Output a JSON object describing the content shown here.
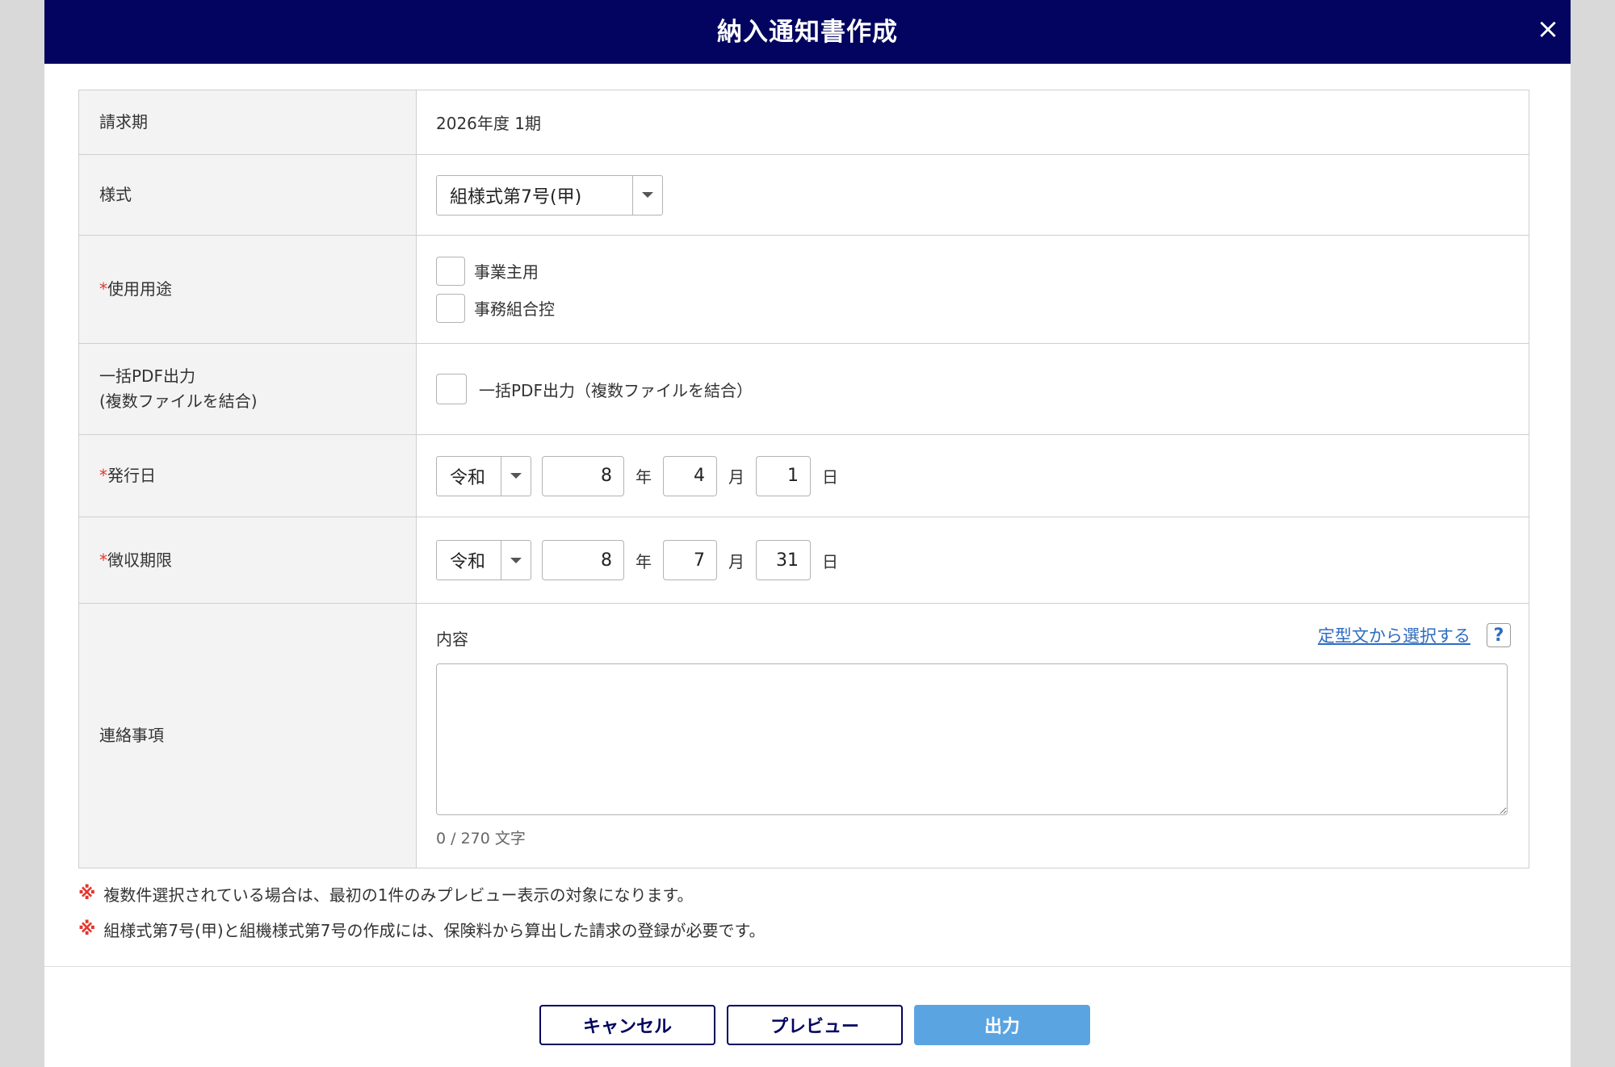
{
  "header": {
    "title": "納入通知書作成",
    "close_symbol": "×"
  },
  "rows": {
    "billing_period": {
      "label": "請求期",
      "value": "2026年度 1期"
    },
    "format": {
      "label": "様式",
      "selected": "組様式第7号(甲)"
    },
    "usage": {
      "required_mark": "*",
      "label": "使用用途",
      "options": [
        "事業主用",
        "事務組合控"
      ]
    },
    "bulk_pdf": {
      "label_line1": "一括PDF出力",
      "label_line2": "(複数ファイルを結合)",
      "option": "一括PDF出力（複数ファイルを結合）"
    },
    "issue_date": {
      "required_mark": "*",
      "label": "発行日",
      "era": "令和",
      "year": "8",
      "month": "4",
      "day": "1"
    },
    "deadline": {
      "required_mark": "*",
      "label": "徴収期限",
      "era": "令和",
      "year": "8",
      "month": "7",
      "day": "31"
    },
    "contact": {
      "label": "連絡事項",
      "content_label": "内容",
      "template_link": "定型文から選択する",
      "help_symbol": "?",
      "counter": "0 / 270 文字"
    }
  },
  "units": {
    "year": "年",
    "month": "月",
    "day": "日"
  },
  "notes": {
    "mark": "※",
    "items": [
      "複数件選択されている場合は、最初の1件のみプレビュー表示の対象になります。",
      "組様式第7号(甲)と組機様式第7号の作成には、保険料から算出した請求の登録が必要です。"
    ]
  },
  "buttons": {
    "cancel": "キャンセル",
    "preview": "プレビュー",
    "output": "出力"
  },
  "colors": {
    "header_bg": "#02045f",
    "required": "#e4352d",
    "link": "#2d6cc0",
    "primary_button": "#5aa4e2"
  }
}
